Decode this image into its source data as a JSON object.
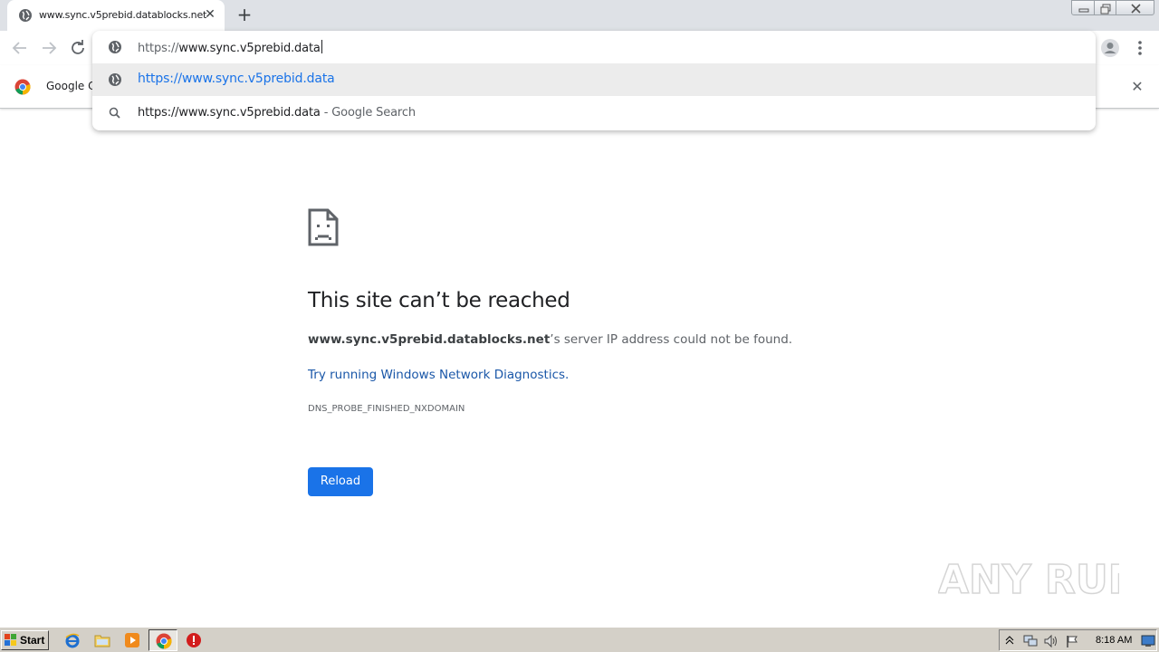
{
  "tab": {
    "title": "www.sync.v5prebid.datablocks.net",
    "close_glyph": "✕",
    "favicon": "globe-icon"
  },
  "new_tab_glyph": "+",
  "toolbar": {
    "back_icon": "arrow-left-icon",
    "forward_icon": "arrow-right-icon",
    "reload_icon": "reload-icon",
    "profile_icon": "profile-icon",
    "menu_icon": "kebab-menu-icon"
  },
  "omnibox": {
    "input_proto": "https://",
    "input_rest": "www.sync.v5prebid.data",
    "suggestions": [
      {
        "icon": "globe-icon",
        "text": "https://www.sync.v5prebid.data",
        "desc": ""
      },
      {
        "icon": "search-icon",
        "text": "https://www.sync.v5prebid.data",
        "desc": " - Google Search"
      }
    ]
  },
  "infobar": {
    "text": "Google Cł",
    "close_glyph": "✕"
  },
  "error": {
    "title": "This site can’t be reached",
    "host": "www.sync.v5prebid.datablocks.net",
    "message_rest": "’s server IP address could not be found.",
    "diagnostics_link": "Try running Windows Network Diagnostics.",
    "code": "DNS_PROBE_FINISHED_NXDOMAIN",
    "reload_label": "Reload"
  },
  "watermark": {
    "text": "ANY RUN"
  },
  "taskbar": {
    "start_label": "Start",
    "clock": "8:18 AM"
  },
  "colors": {
    "accent": "#1a73e8",
    "link": "#1a57a8",
    "tabstrip": "#dee1e6",
    "taskbar": "#d4d0c8"
  }
}
